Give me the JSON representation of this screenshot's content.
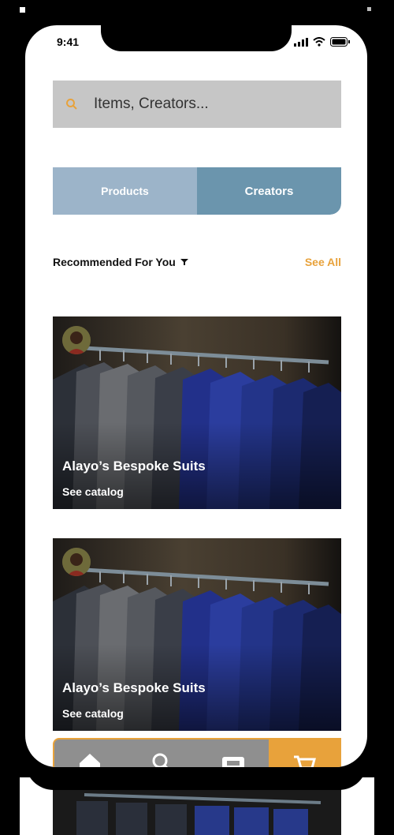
{
  "status_bar": {
    "time": "9:41"
  },
  "search": {
    "placeholder": "Items, Creators..."
  },
  "tabs": [
    {
      "label": "Products",
      "active": false
    },
    {
      "label": "Creators",
      "active": true
    }
  ],
  "section": {
    "title": "Recommended For You",
    "see_all": "See All"
  },
  "cards": [
    {
      "title": "Alayo’s Bespoke Suits",
      "link": "See catalog"
    },
    {
      "title": "Alayo’s Bespoke Suits",
      "link": "See catalog"
    }
  ],
  "bottom_nav": {
    "items": [
      "home-icon",
      "search-icon",
      "store-icon",
      "cart-icon"
    ],
    "active": "cart-icon"
  },
  "colors": {
    "accent": "#e8a23b",
    "tab_inactive": "#9cb4c9",
    "tab_active": "#6b95ad",
    "search_bg": "#c6c6c6"
  }
}
